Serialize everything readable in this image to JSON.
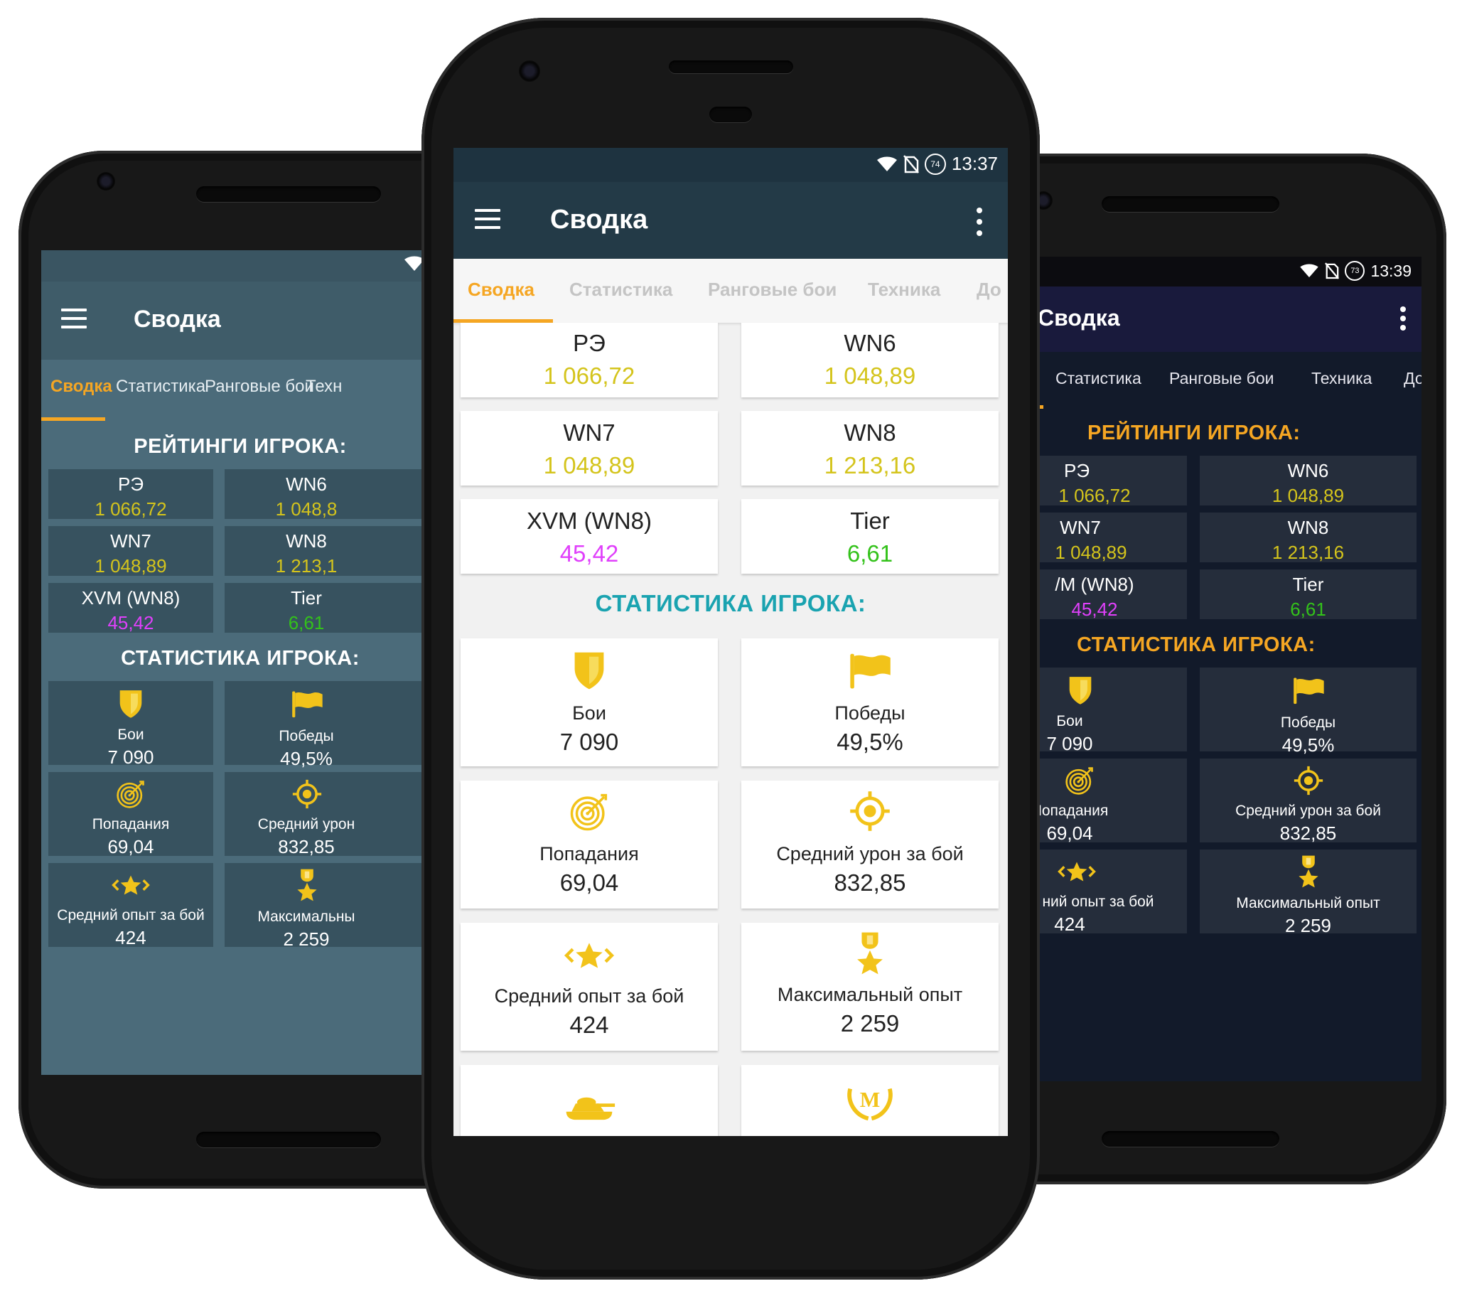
{
  "colors": {
    "accent_orange": "#f5a623",
    "value_yellow": "#d4c41c",
    "value_magenta": "#e040fb",
    "value_green": "#33c21a",
    "teal_heading": "#1aa3b0",
    "icon_gold": "#f2c31a"
  },
  "center": {
    "status": {
      "time": "13:37",
      "battery": "74"
    },
    "title": "Сводка",
    "tabs": [
      "Сводка",
      "Статистика",
      "Ранговые бои",
      "Техника",
      "До"
    ],
    "ratings": [
      {
        "label": "РЭ",
        "value": "1 066,72",
        "color": "yellow"
      },
      {
        "label": "WN6",
        "value": "1 048,89",
        "color": "yellow"
      },
      {
        "label": "WN7",
        "value": "1 048,89",
        "color": "yellow"
      },
      {
        "label": "WN8",
        "value": "1 213,16",
        "color": "yellow"
      },
      {
        "label": "XVM (WN8)",
        "value": "45,42",
        "color": "magenta"
      },
      {
        "label": "Tier",
        "value": "6,61",
        "color": "green"
      }
    ],
    "stats_heading": "СТАТИСТИКА ИГРОКА:",
    "stats": [
      {
        "icon": "shield-icon",
        "label": "Бои",
        "value": "7 090"
      },
      {
        "icon": "flag-icon",
        "label": "Победы",
        "value": "49,5%"
      },
      {
        "icon": "target-icon",
        "label": "Попадания",
        "value": "69,04"
      },
      {
        "icon": "crosshair-icon",
        "label": "Средний урон за бой",
        "value": "832,85"
      },
      {
        "icon": "star-arrows-icon",
        "label": "Средний опыт за бой",
        "value": "424"
      },
      {
        "icon": "medal-icon",
        "label": "Максимальный опыт",
        "value": "2 259"
      }
    ],
    "bottom_icons": [
      "tank-icon",
      "mastery-badge-icon"
    ]
  },
  "left": {
    "title": "Сводка",
    "tabs": [
      "Сводка",
      "Статистика",
      "Ранговые бои",
      "Техн"
    ],
    "ratings_heading": "РЕЙТИНГИ ИГРОКА:",
    "ratings": [
      {
        "label": "РЭ",
        "value": "1 066,72",
        "color": "yellow"
      },
      {
        "label": "WN6",
        "value": "1 048,8",
        "color": "yellow"
      },
      {
        "label": "WN7",
        "value": "1 048,89",
        "color": "yellow"
      },
      {
        "label": "WN8",
        "value": "1 213,1",
        "color": "yellow"
      },
      {
        "label": "XVM (WN8)",
        "value": "45,42",
        "color": "magenta"
      },
      {
        "label": "Tier",
        "value": "6,61",
        "color": "green"
      }
    ],
    "stats_heading": "СТАТИСТИКА ИГРОКА:",
    "stats": [
      {
        "icon": "shield-icon",
        "label": "Бои",
        "value": "7 090"
      },
      {
        "icon": "flag-icon",
        "label": "Победы",
        "value": "49,5%"
      },
      {
        "icon": "target-icon",
        "label": "Попадания",
        "value": "69,04"
      },
      {
        "icon": "crosshair-icon",
        "label": "Средний урон",
        "value": "832,85"
      },
      {
        "icon": "star-arrows-icon",
        "label": "Средний опыт за бой",
        "value": "424"
      },
      {
        "icon": "medal-icon",
        "label": "Максимальны",
        "value": "2 259"
      }
    ]
  },
  "right": {
    "status": {
      "time": "13:39",
      "battery": "73"
    },
    "title": "Сводка",
    "tabs": [
      "Статистика",
      "Ранговые бои",
      "Техника",
      "До"
    ],
    "ratings_heading": "РЕЙТИНГИ ИГРОКА:",
    "ratings": [
      {
        "label": "РЭ",
        "value": "1 066,72",
        "color": "yellow"
      },
      {
        "label": "WN6",
        "value": "1 048,89",
        "color": "yellow"
      },
      {
        "label": "WN7",
        "value": "1 048,89",
        "color": "yellow"
      },
      {
        "label": "WN8",
        "value": "1 213,16",
        "color": "yellow"
      },
      {
        "label": "/M (WN8)",
        "value": "45,42",
        "color": "magenta"
      },
      {
        "label": "Tier",
        "value": "6,61",
        "color": "green"
      }
    ],
    "stats_heading": "СТАТИСТИКА ИГРОКА:",
    "stats": [
      {
        "icon": "shield-icon",
        "label": "Бои",
        "value": "7 090"
      },
      {
        "icon": "flag-icon",
        "label": "Победы",
        "value": "49,5%"
      },
      {
        "icon": "target-icon",
        "label": "Попадания",
        "value": "69,04"
      },
      {
        "icon": "crosshair-icon",
        "label": "Средний урон за бой",
        "value": "832,85"
      },
      {
        "icon": "star-arrows-icon",
        "label": "ний опыт за бой",
        "value": "424"
      },
      {
        "icon": "medal-icon",
        "label": "Максимальный опыт",
        "value": "2 259"
      }
    ]
  }
}
